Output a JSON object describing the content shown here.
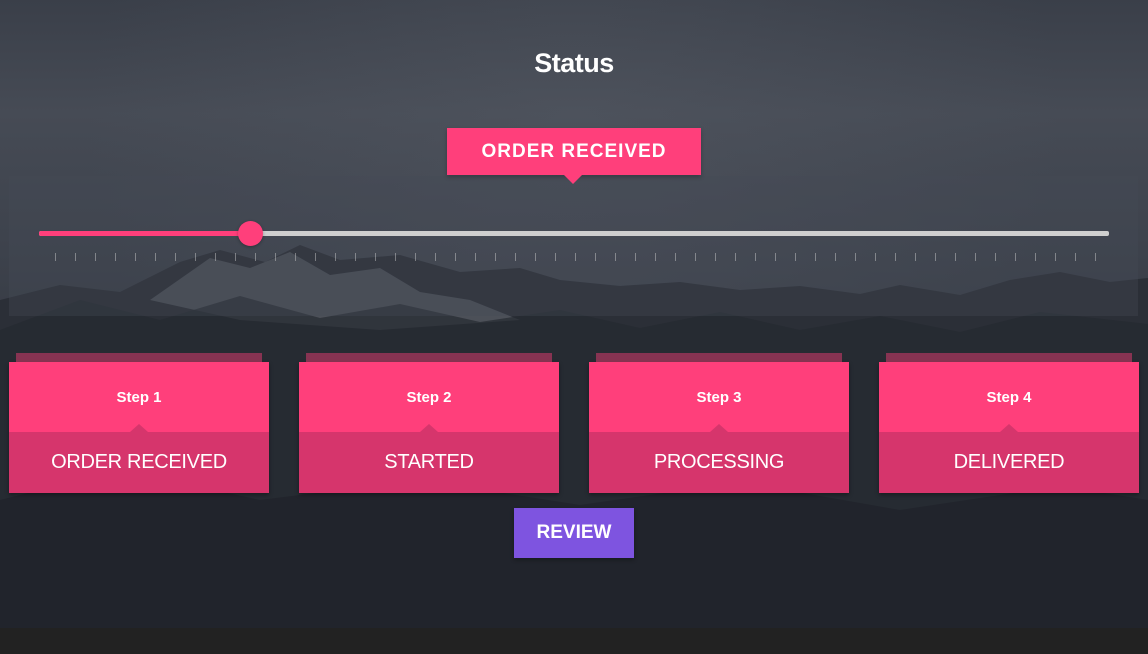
{
  "page": {
    "title": "Status"
  },
  "status_tag": {
    "label": "ORDER RECEIVED"
  },
  "slider": {
    "value_fraction": 0.198,
    "tick_count": 53
  },
  "steps": [
    {
      "step_label": "Step 1",
      "name": "ORDER RECEIVED"
    },
    {
      "step_label": "Step 2",
      "name": "STARTED"
    },
    {
      "step_label": "Step 3",
      "name": "PROCESSING"
    },
    {
      "step_label": "Step 4",
      "name": "DELIVERED"
    }
  ],
  "review_button": {
    "label": "REVIEW"
  },
  "colors": {
    "accent": "#ff3f7b",
    "accent_dark": "#d6356c",
    "track": "#cfcfcf",
    "review": "#7e54e0",
    "background": "#3a3f49"
  }
}
